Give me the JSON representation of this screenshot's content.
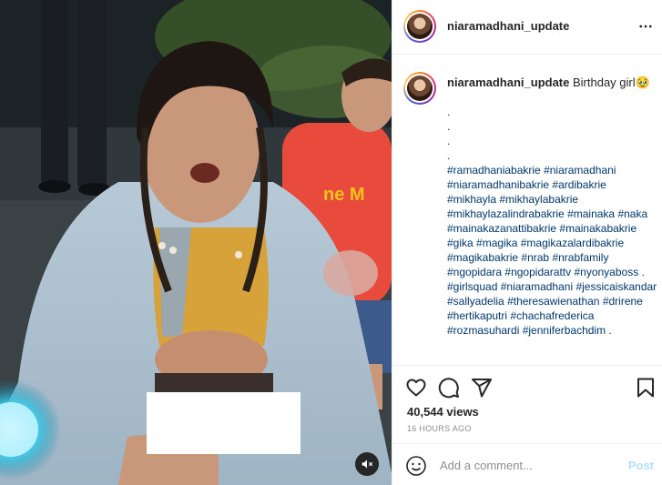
{
  "post": {
    "username": "niaramadhani_update",
    "caption_text": " Birthday girl🥹",
    "caption_dots": ".\n.\n.\n.",
    "hashtags": [
      "#ramadhaniabakrie",
      "#niaramadhani",
      "#niaramadhanibakrie",
      "#ardibakrie",
      "#mikhayla",
      "#mikhaylabakrie",
      "#mikhaylazalindrabakrie",
      "#mainaka",
      "#naka",
      "#mainakazanattibakrie",
      "#mainakabakrie",
      "#gika",
      "#magika",
      "#magikazalardibakrie",
      "#magikabakrie",
      "#nrab",
      "#nrabfamily",
      "#ngopidara",
      "#ngopidarattv",
      "#nyonyaboss .",
      "#girlsquad",
      "#niaramadhani",
      "#jessicaiskandar",
      "#sallyadelia",
      "#theresawienathan",
      "#drirene",
      "#hertikaputri",
      "#chachafrederica",
      "#rozmasuhardi",
      "#jenniferbachdim ."
    ],
    "views": "40,544 views",
    "time_ago": "16 HOURS AGO"
  },
  "comment": {
    "placeholder": "Add a comment...",
    "post_label": "Post"
  },
  "icons": {
    "more": "more-horizontal-icon",
    "like": "heart-icon",
    "comment": "comment-bubble-icon",
    "share": "paper-plane-icon",
    "save": "bookmark-icon",
    "emoji": "smiley-icon",
    "mute": "speaker-muted-icon"
  },
  "colors": {
    "text": "#262626",
    "muted": "#8e8e8e",
    "hashtag": "#00376b",
    "post_disabled": "#b2dffc",
    "divider": "#efefef"
  }
}
